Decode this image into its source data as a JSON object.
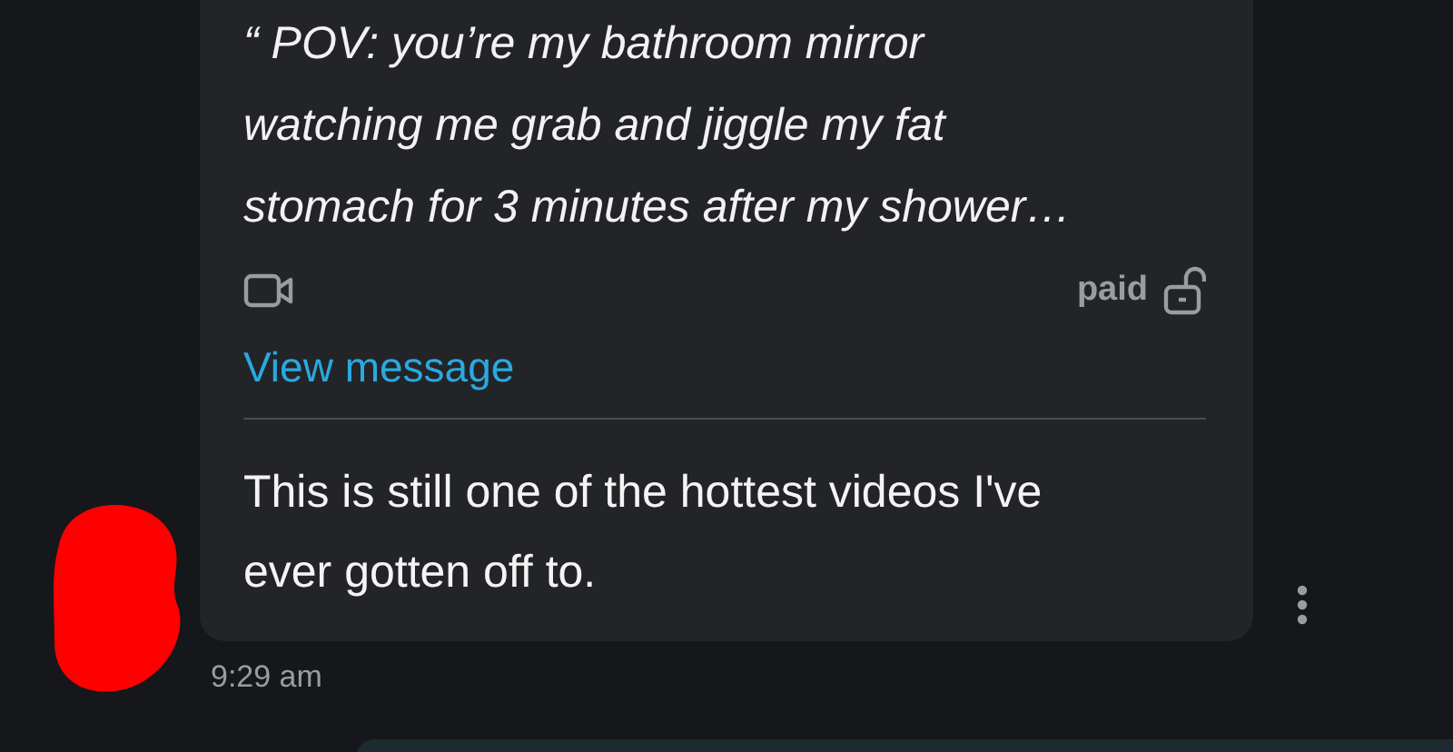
{
  "message": {
    "quote": "“ POV: you’re my bathroom mirror watching me grab and jiggle my fat stomach for 3 minutes after my shower…",
    "media": {
      "kind": "video",
      "price_label": "paid",
      "unlocked": true
    },
    "view_link": "View message",
    "text": "This is still one of the hottest videos I've ever gotten off to.",
    "time": "9:29 am"
  }
}
